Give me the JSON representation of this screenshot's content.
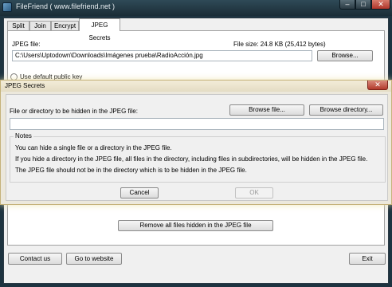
{
  "window": {
    "title": "FileFriend ( www.filefriend.net )",
    "minimize_glyph": "–",
    "maximize_glyph": "□",
    "close_glyph": "✕"
  },
  "tabs": [
    {
      "label": "Split"
    },
    {
      "label": "Join"
    },
    {
      "label": "Encrypt"
    },
    {
      "label": "JPEG Secrets",
      "active": true
    }
  ],
  "jpeg_panel": {
    "jpeg_file_label": "JPEG file:",
    "file_size_label": "File size: 24.8 KB (25,412 bytes)",
    "jpeg_file_path": "C:\\Users\\Uptodown\\Downloads\\Imágenes prueba\\RadioAcción.jpg",
    "browse_label": "Browse...",
    "use_default_key_label": "Use default public key",
    "remove_all_label": "Remove all files hidden in the JPEG file"
  },
  "footer": {
    "contact_label": "Contact us",
    "website_label": "Go to website",
    "exit_label": "Exit"
  },
  "dialog": {
    "title": "JPEG Secrets",
    "close_glyph": "✕",
    "prompt_label": "File or directory to be hidden in the JPEG file:",
    "browse_file_label": "Browse file...",
    "browse_directory_label": "Browse directory...",
    "path_value": "",
    "notes_legend": "Notes",
    "notes": [
      "You can hide a single file or a directory in the JPEG file.",
      "If you hide a directory in the JPEG file, all files in the directory, including files in subdirectories, will be hidden in the JPEG file.",
      "The JPEG file should not be in the directory which is to be hidden in the JPEG file."
    ],
    "cancel_label": "Cancel",
    "ok_label": "OK"
  },
  "colors": {
    "window_frame": "#1d3340",
    "dialog_frame": "#ece8dc",
    "close_button": "#b0352a"
  }
}
